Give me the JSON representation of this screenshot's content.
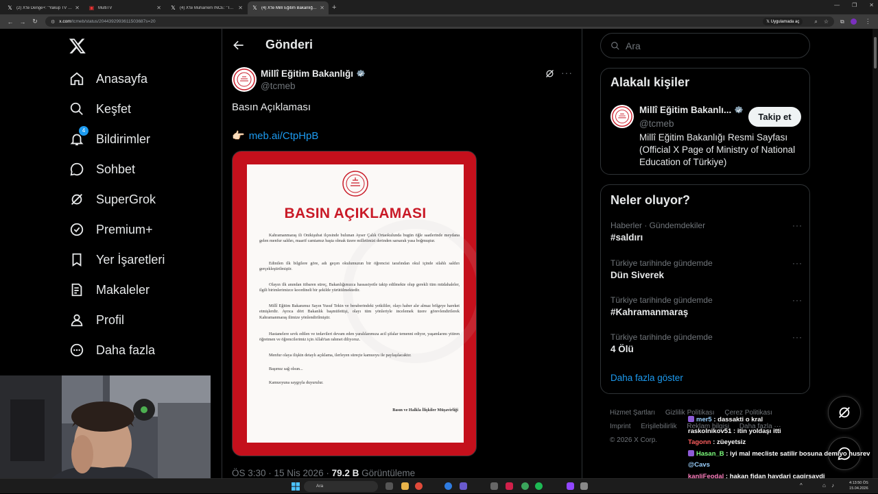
{
  "browser": {
    "tabs": [
      {
        "title": "(2) X'te Denge+: \"Yakup TV nin",
        "active": false
      },
      {
        "title": "MultiTV",
        "active": false
      },
      {
        "title": "(4) X'te Muharrem İNCE: \"Tekin",
        "active": false
      },
      {
        "title": "(4) X'te Millî Eğitim Bakanlığı: \"Bas",
        "active": true
      }
    ],
    "url_host": "x.com",
    "url_path": "/tcmeb/status/2044392993611503687s=20",
    "app_chip": "Uygulamada aç"
  },
  "nav": {
    "items": [
      {
        "id": "home",
        "label": "Anasayfa"
      },
      {
        "id": "explore",
        "label": "Keşfet"
      },
      {
        "id": "notifications",
        "label": "Bildirimler",
        "badge": "4"
      },
      {
        "id": "chat",
        "label": "Sohbet"
      },
      {
        "id": "supergrok",
        "label": "SuperGrok"
      },
      {
        "id": "premium",
        "label": "Premium+"
      },
      {
        "id": "bookmarks",
        "label": "Yer İşaretleri"
      },
      {
        "id": "articles",
        "label": "Makaleler"
      },
      {
        "id": "profile",
        "label": "Profil"
      },
      {
        "id": "more",
        "label": "Daha fazla"
      }
    ]
  },
  "post": {
    "header_title": "Gönderi",
    "author_name": "Millî Eğitim Bakanlığı",
    "author_handle": "@tcmeb",
    "text": "Basın Açıklaması",
    "link_emoji": "👉🏻",
    "link": "meb.ai/CtpHpB",
    "meta_time": "ÖS 3:30 · 15 Nis 2026 · ",
    "meta_views": "79.2 B",
    "meta_views_label": " Görüntüleme"
  },
  "document": {
    "title": "BASIN AÇIKLAMASI",
    "paragraphs": [
      "Kahramanmaraş ili Onikişubat ilçesinde bulunan Ayser Çalık Ortaokulunda bugün öğle saatlerinde meydana gelen menfur saldırı, maarif camiamız başta olmak üzere milletimizi derinden sarsarak yasa boğmuştur.",
      "Edinilen ilk bilgilere göre, adı geçen okulumuzun bir öğrencisi tarafından okul içinde silahlı saldırı gerçekleştirilmiştir.",
      "Olayın ilk anından itibaren süreç, Bakanlığımızca hassasiyetle takip edilmekte olup gerekli tüm müdahaleler, ilgili birimlerimizce koordineli bir şekilde yürütülmektedir.",
      "Millî Eğitim Bakanımız Sayın Yusuf Tekin ve beraberindeki yetkililer, olayı haber alır almaz bölgeye hareket etmişlerdir. Ayrıca dört Bakanlık başmüfettişi, olayı tüm yönleriyle incelemek üzere görevlendirilerek Kahramanmaraş ilimize yönlendirilmiştir.",
      "Hastanelere sevk edilen ve tedavileri devam eden yaralılarımıza acil şifalar temenni ediyor, yaşamlarını yitiren öğretmen ve öğrencilerimiz için Allah'tan rahmet diliyoruz.",
      "Menfur olaya ilişkin detaylı açıklama, ilerleyen süreçte kamuoyu ile paylaşılacaktır.",
      "Başımız sağ olsun...",
      "Kamuoyuna saygıyla duyurulur."
    ],
    "signature": "Basın ve Halkla İlişkiler Müşavirliği"
  },
  "sidebar": {
    "search_placeholder": "Ara",
    "related_title": "Alakalı kişiler",
    "related": {
      "name": "Millî Eğitim Bakanlı...",
      "handle": "@tcmeb",
      "follow_label": "Takip et",
      "bio": "Millî Eğitim Bakanlığı Resmi Sayfası (Official X Page of Ministry of National Education of Türkiye)"
    },
    "trends_title": "Neler oluyor?",
    "trends": [
      {
        "category": "Haberler · Gündemdekiler",
        "name": "#saldırı"
      },
      {
        "category": "Türkiye tarihinde gündemde",
        "name": "Dün Siverek"
      },
      {
        "category": "Türkiye tarihinde gündemde",
        "name": "#Kahramanmaraş"
      },
      {
        "category": "Türkiye tarihinde gündemde",
        "name": "4 Ölü"
      }
    ],
    "show_more": "Daha fazla göster",
    "footer": [
      "Hizmet Şartları",
      "Gizlilik Politikası",
      "Çerez Politikası",
      "Imprint",
      "Erişilebilirlik",
      "Reklam bilgisi",
      "Daha fazla ···",
      "© 2026 X Corp."
    ]
  },
  "chat": [
    {
      "user": "mer5",
      "text": " : dassakti o kral",
      "color": "#9bd1ff",
      "sub": true
    },
    {
      "user": "raskolnikov51",
      "text": " : itin yoldaşı itti",
      "color": "#ffffff",
      "sub": false
    },
    {
      "user": "Tagonn",
      "text": " : züeyetsiz",
      "color": "#ff5f5f",
      "sub": false
    },
    {
      "user": "Hasan_B",
      "text": " : iyi mal mecliste satilir bosuna demiyo husrev",
      "color": "#7dff7d",
      "sub": true
    },
    {
      "user": "@Cavs",
      "text": "",
      "color": "#9bd1ff",
      "sub": false
    },
    {
      "user": "kanliFeodal",
      "text": " : hakan fidan haydari cagirsaydi",
      "color": "#ff7fbf",
      "sub": false
    },
    {
      "user": "ar",
      "text": "",
      "color": "#ffffff",
      "sub": false
    }
  ],
  "taskbar": {
    "search_placeholder": "Ara",
    "time": "4:13:50 ÖS",
    "date": "15.04.2026"
  },
  "colors": {
    "accent": "#1d9bf0",
    "doc_frame": "#c4101c",
    "doc_title": "#c91a27"
  }
}
